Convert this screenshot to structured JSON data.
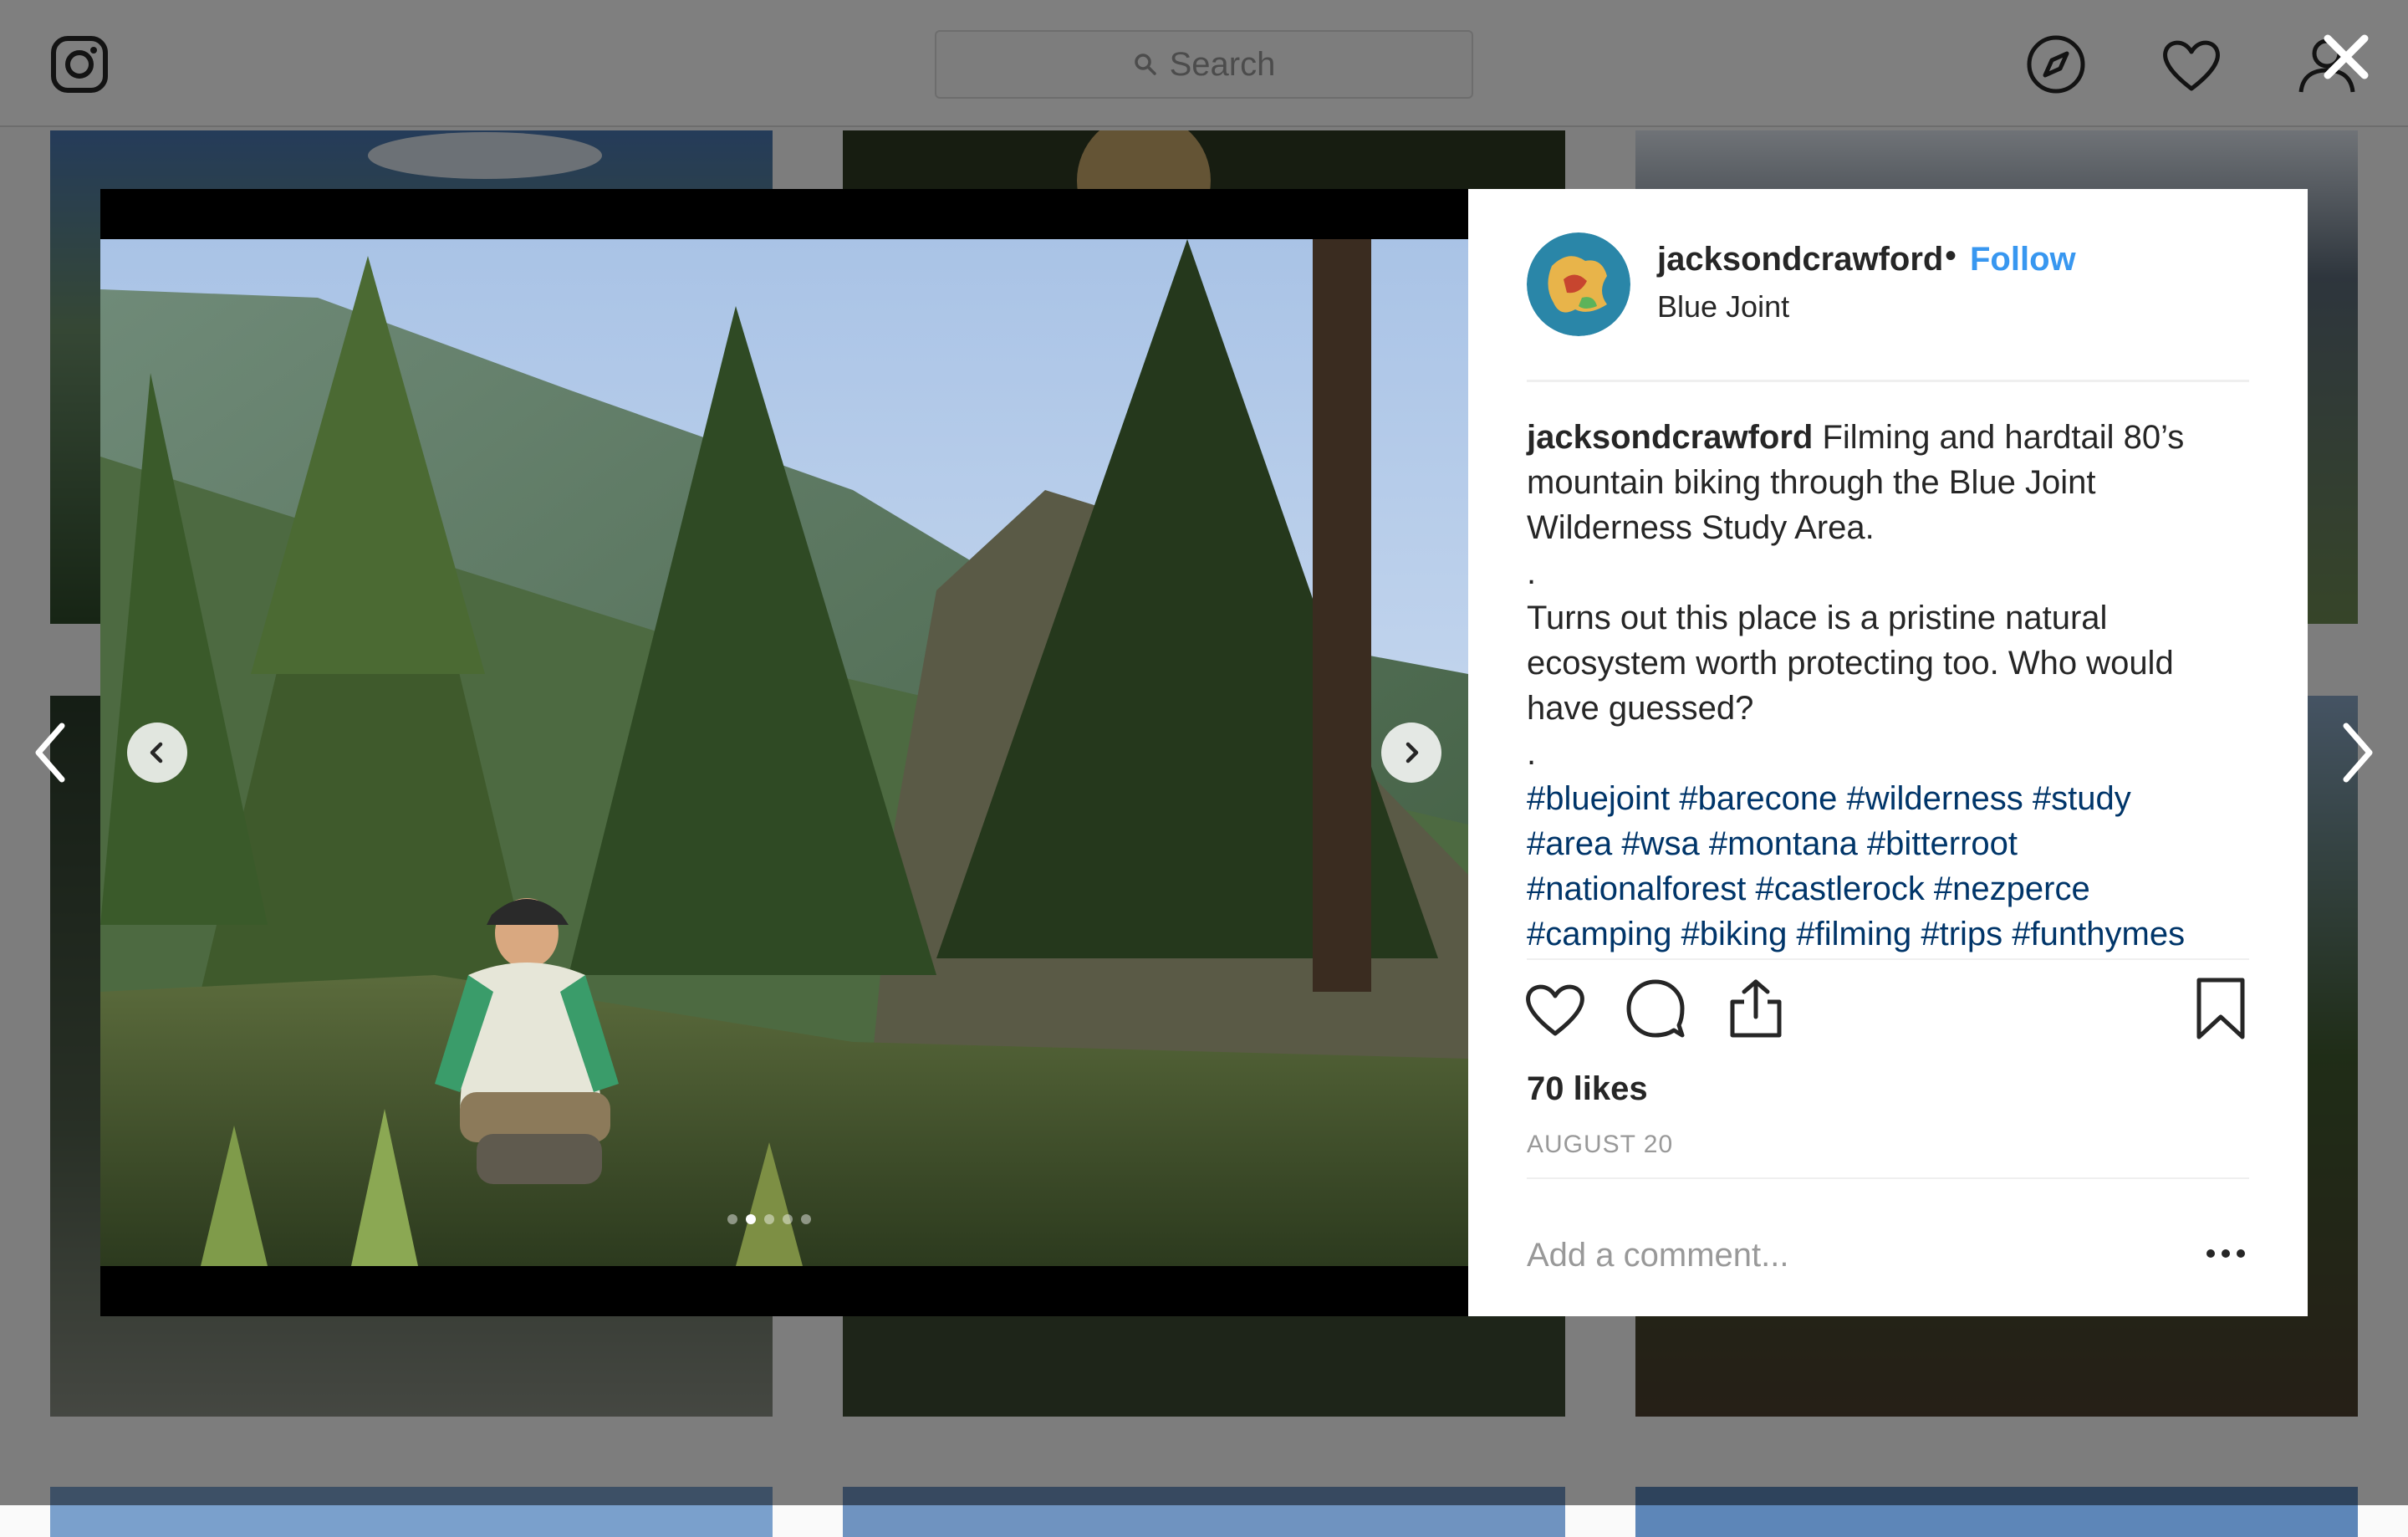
{
  "nav": {
    "search_placeholder": "Search",
    "icons": [
      "instagram-logo-icon",
      "search-icon",
      "compass-icon",
      "heart-icon",
      "profile-icon"
    ]
  },
  "post": {
    "username": "jacksondcrawford",
    "follow_label": "Follow",
    "location": "Blue Joint",
    "caption_user": "jacksondcrawford",
    "caption_lines": [
      "Filming and hardtail 80’s",
      "mountain biking through the Blue Joint",
      "Wilderness Study Area.",
      ".",
      "Turns out this place is a pristine natural",
      "ecosystem worth protecting too. Who would",
      "have guessed?",
      "."
    ],
    "hashtag_lines": [
      "#bluejoint #barecone #wilderness #study",
      "#area #wsa #montana #bitterroot",
      "#nationalforest #castlerock #nezperce",
      "#camping #biking #filming #trips #funthymes"
    ],
    "likes": "70 likes",
    "date": "AUGUST 20",
    "comment_placeholder": "Add a comment...",
    "carousel": {
      "count": 5,
      "active": 1
    }
  },
  "colors": {
    "follow": "#3897f0",
    "hashtag": "#003569",
    "overlay": "rgba(0,0,0,0.5)"
  }
}
